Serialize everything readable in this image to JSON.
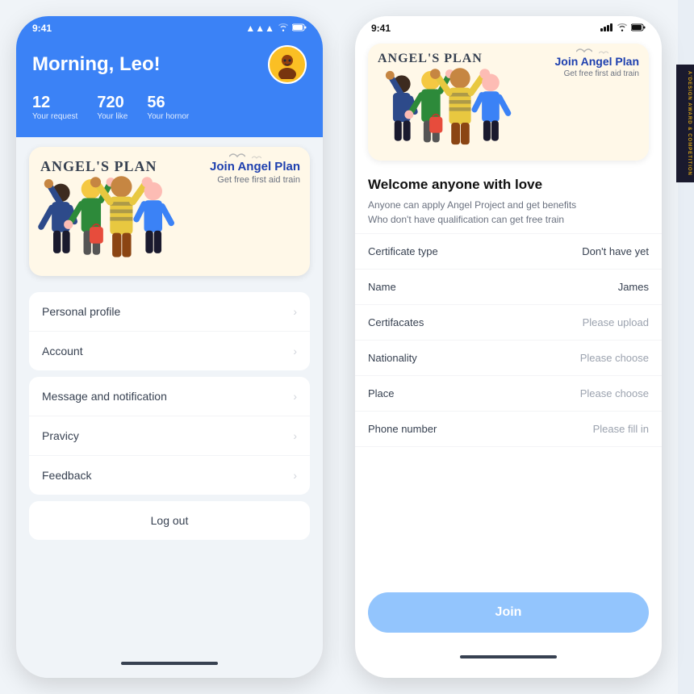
{
  "left_phone": {
    "status_bar": {
      "time": "9:41",
      "signal": "▲▲▲",
      "wifi": "WiFi",
      "battery": "🔋"
    },
    "header": {
      "greeting": "Morning, Leo!",
      "stats": [
        {
          "number": "12",
          "label": "Your request"
        },
        {
          "number": "720",
          "label": "Your like"
        },
        {
          "number": "56",
          "label": "Your hornor"
        }
      ]
    },
    "angel_card": {
      "title_text": "ANGEL'S  PLAN",
      "join_title": "Join Angel Plan",
      "join_sub": "Get free first aid train"
    },
    "menu": {
      "section1": [
        {
          "label": "Personal profile"
        },
        {
          "label": "Account"
        }
      ],
      "section2": [
        {
          "label": "Message and notification"
        },
        {
          "label": "Pravicy"
        },
        {
          "label": "Feedback"
        }
      ],
      "logout": "Log out"
    }
  },
  "right_phone": {
    "status_bar": {
      "time": "9:41"
    },
    "angel_card": {
      "title_text": "ANGEL'S  PLAN",
      "join_title": "Join Angel Plan",
      "join_sub": "Get free first aid train"
    },
    "welcome": {
      "title": "Welcome anyone with love",
      "lines": [
        "Anyone  can apply Angel Project and get benefits",
        "Who don't have qualification can get free train"
      ]
    },
    "form": {
      "rows": [
        {
          "label": "Certificate type",
          "value": "Don't have yet",
          "dark": true
        },
        {
          "label": "Name",
          "value": "James",
          "dark": true
        },
        {
          "label": "Certifacates",
          "value": "Please upload",
          "dark": false
        },
        {
          "label": "Nationality",
          "value": "Please choose",
          "dark": false
        },
        {
          "label": "Place",
          "value": "Please choose",
          "dark": false
        },
        {
          "label": "Phone number",
          "value": "Please fill in",
          "dark": false
        }
      ]
    },
    "join_button": "Join"
  },
  "award_badge": "A'DESIGN AWARD & COMPETITION"
}
